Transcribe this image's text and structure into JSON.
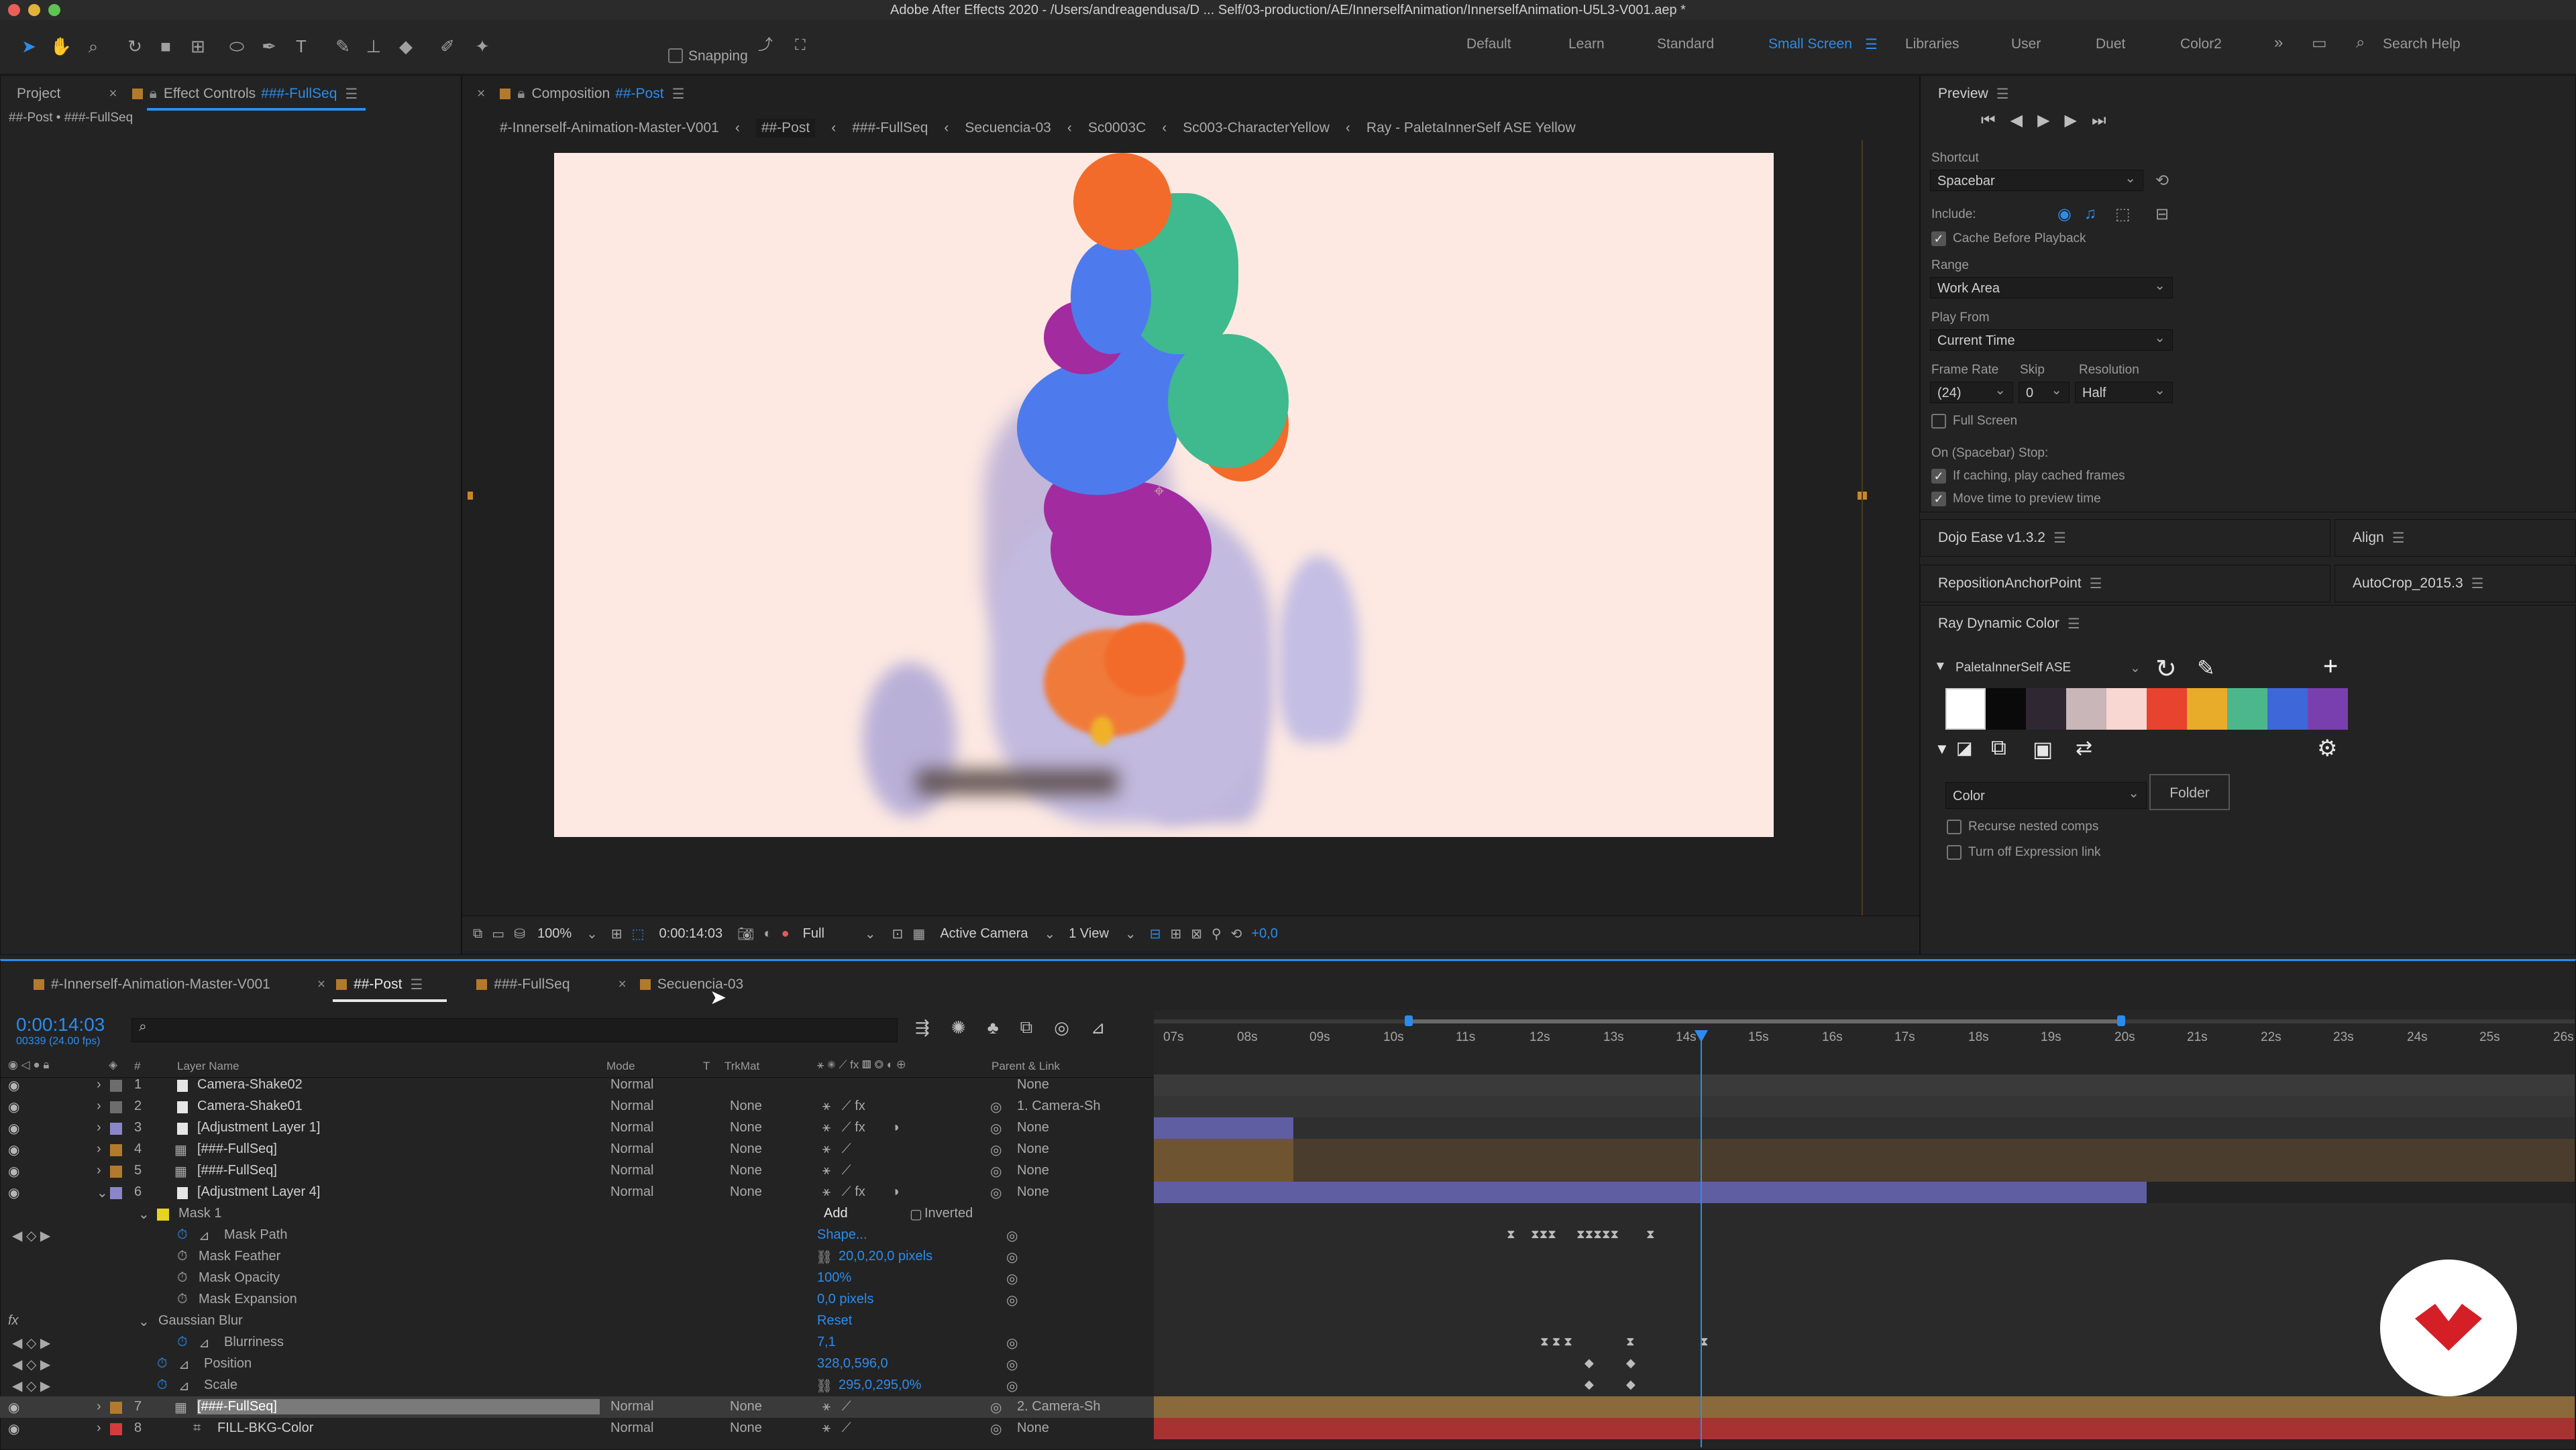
{
  "window": {
    "title": "Adobe After Effects 2020 - /Users/andreagendusa/D ... Self/03-production/AE/InnerselfAnimation/InnerselfAnimation-U5L3-V001.aep *",
    "controls": {
      "close_color": "#ec5f57",
      "min_color": "#e0b43a",
      "max_color": "#5fc451"
    }
  },
  "toolbar": {
    "snapping_label": "Snapping",
    "workspaces": [
      "Default",
      "Learn",
      "Standard",
      "Small Screen",
      "Libraries",
      "User",
      "Duet",
      "Color2"
    ],
    "active_workspace": "Small Screen",
    "search_label": "Search Help"
  },
  "left_panel": {
    "tab_project": "Project",
    "tab_effect_controls": "Effect Controls",
    "effect_controls_layer": "###-FullSeq",
    "subtitle": "##-Post • ###-FullSeq"
  },
  "composition": {
    "tab_label": "Composition",
    "tab_comp": "##-Post",
    "breadcrumbs": [
      "#-Innerself-Animation-Master-V001",
      "##-Post",
      "###-FullSeq",
      "Secuencia-03",
      "Sc0003C",
      "Sc003-CharacterYellow",
      "Ray - PaletaInnerSelf ASE Yellow"
    ],
    "active_crumb": "##-Post",
    "background_color": "#fde9e2",
    "footer": {
      "zoom": "100%",
      "timecode": "0:00:14:03",
      "resolution": "Full",
      "camera": "Active Camera",
      "view": "1 View",
      "exposure": "+0,0"
    }
  },
  "preview": {
    "title": "Preview",
    "shortcut_label": "Shortcut",
    "shortcut_value": "Spacebar",
    "include_label": "Include:",
    "cache_before_playback": "Cache Before Playback",
    "range_label": "Range",
    "range_value": "Work Area",
    "play_from_label": "Play From",
    "play_from_value": "Current Time",
    "frame_rate_label": "Frame Rate",
    "skip_label": "Skip",
    "resolution_label": "Resolution",
    "frame_rate_value": "(24)",
    "skip_value": "0",
    "resolution_value": "Half",
    "full_screen": "Full Screen",
    "on_stop_label": "On (Spacebar) Stop:",
    "if_caching": "If caching, play cached frames",
    "move_time": "Move time to preview time"
  },
  "extensions": {
    "dojo": "Dojo Ease v1.3.2",
    "align": "Align",
    "reposition": "RepositionAnchorPoint",
    "autocrop": "AutoCrop_2015.3",
    "ray": "Ray Dynamic Color",
    "palette_name": "PaletaInnerSelf ASE",
    "swatches": [
      "#ffffff",
      "#0a0a0a",
      "#2f2833",
      "#c9b6b8",
      "#f8d6d2",
      "#e8432f",
      "#e9ab2a",
      "#4db78c",
      "#3e67d9",
      "#7a3fae"
    ],
    "color_mode": "Color",
    "folder_button": "Folder",
    "recurse": "Recurse nested comps",
    "turn_off_expr": "Turn off Expression link"
  },
  "timeline": {
    "tabs": [
      "#-Innerself-Animation-Master-V001",
      "##-Post",
      "###-FullSeq",
      "Secuencia-03"
    ],
    "active_tab": "##-Post",
    "timecode": "0:00:14:03",
    "frame_info": "00339 (24.00 fps)",
    "columns": {
      "layer_name": "Layer Name",
      "mode": "Mode",
      "t": "T",
      "trkmat": "TrkMat",
      "parent": "Parent & Link"
    },
    "ruler": [
      "07s",
      "08s",
      "09s",
      "10s",
      "11s",
      "12s",
      "13s",
      "14s",
      "15s",
      "16s",
      "17s",
      "18s",
      "19s",
      "20s",
      "21s",
      "22s",
      "23s",
      "24s",
      "25s",
      "26s"
    ],
    "layers": [
      {
        "num": "1",
        "name": "Camera-Shake02",
        "mode": "Normal",
        "trkmat": "",
        "parent": "None",
        "label_color": "#6d6d6d"
      },
      {
        "num": "2",
        "name": "Camera-Shake01",
        "mode": "Normal",
        "trkmat": "None",
        "parent": "1. Camera-Sh",
        "label_color": "#6d6d6d"
      },
      {
        "num": "3",
        "name": "[Adjustment Layer 1]",
        "mode": "Normal",
        "trkmat": "None",
        "parent": "None",
        "label_color": "#8b86c9"
      },
      {
        "num": "4",
        "name": "[###-FullSeq]",
        "mode": "Normal",
        "trkmat": "None",
        "parent": "None",
        "label_color": "#b37a2d"
      },
      {
        "num": "5",
        "name": "[###-FullSeq]",
        "mode": "Normal",
        "trkmat": "None",
        "parent": "None",
        "label_color": "#b37a2d"
      },
      {
        "num": "6",
        "name": "[Adjustment Layer 4]",
        "mode": "Normal",
        "trkmat": "None",
        "parent": "None",
        "label_color": "#8b86c9"
      }
    ],
    "mask": {
      "name": "Mask 1",
      "mode": "Add",
      "inverted": "Inverted",
      "props": [
        {
          "name": "Mask Path",
          "value": "Shape..."
        },
        {
          "name": "Mask Feather",
          "value": "20,0,20,0 pixels"
        },
        {
          "name": "Mask Opacity",
          "value": "100%"
        },
        {
          "name": "Mask Expansion",
          "value": "0,0 pixels"
        }
      ]
    },
    "effect": {
      "name": "Gaussian Blur",
      "reset": "Reset",
      "props": [
        {
          "name": "Blurriness",
          "value": "7,1"
        },
        {
          "name": "Position",
          "value": "328,0,596,0"
        },
        {
          "name": "Scale",
          "value": "295,0,295,0%"
        }
      ]
    },
    "bottom_layers": [
      {
        "num": "7",
        "name": "[###-FullSeq]",
        "mode": "Normal",
        "trkmat": "None",
        "parent": "2. Camera-Sh",
        "label_color": "#b37a2d"
      },
      {
        "num": "8",
        "name": "FILL-BKG-Color",
        "mode": "Normal",
        "trkmat": "None",
        "parent": "None",
        "label_color": "#d43b3b"
      }
    ]
  }
}
